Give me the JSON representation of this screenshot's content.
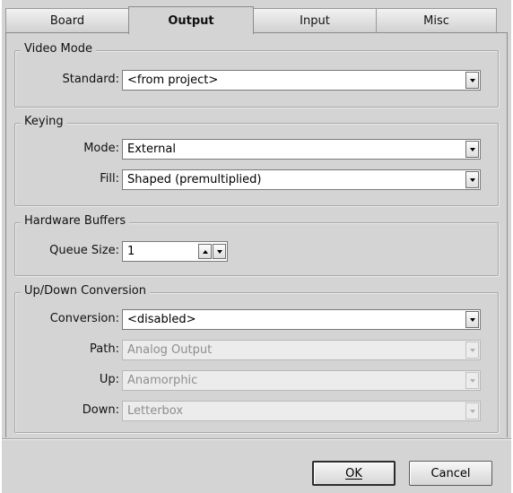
{
  "tabs": [
    {
      "label": "Board",
      "active": false
    },
    {
      "label": "Output",
      "active": true
    },
    {
      "label": "Input",
      "active": false
    },
    {
      "label": "Misc",
      "active": false
    }
  ],
  "video_mode": {
    "title": "Video Mode",
    "standard_label": "Standard:",
    "standard_value": "<from project>"
  },
  "keying": {
    "title": "Keying",
    "mode_label": "Mode:",
    "mode_value": "External",
    "fill_label": "Fill:",
    "fill_value": "Shaped (premultiplied)"
  },
  "hardware_buffers": {
    "title": "Hardware Buffers",
    "queue_size_label": "Queue Size:",
    "queue_size_value": "1"
  },
  "conversion": {
    "title": "Up/Down Conversion",
    "conversion_label": "Conversion:",
    "conversion_value": "<disabled>",
    "path_label": "Path:",
    "path_value": "Analog Output",
    "up_label": "Up:",
    "up_value": "Anamorphic",
    "down_label": "Down:",
    "down_value": "Letterbox"
  },
  "buttons": {
    "ok_label": "OK",
    "cancel_label": "Cancel"
  },
  "colors": {
    "panel_bg": "#d4d4d4",
    "disabled_text": "#8e8e8e"
  }
}
